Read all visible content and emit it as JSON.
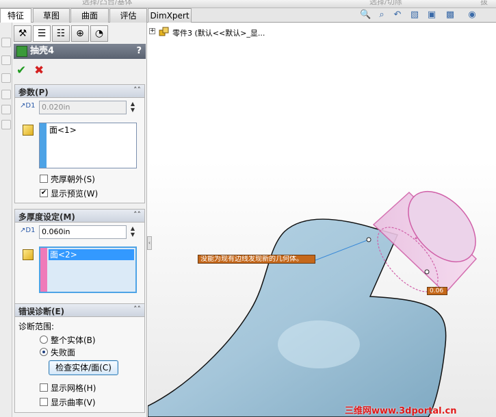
{
  "top_strip": {
    "left_ghost": "选择/凸台/基体",
    "middle_ghost": "选择/切除",
    "right_ghost": "拔"
  },
  "command_tabs": [
    {
      "label": "特征",
      "active": true
    },
    {
      "label": "草图",
      "active": false
    },
    {
      "label": "曲面",
      "active": false
    },
    {
      "label": "评估",
      "active": false
    },
    {
      "label": "DimXpert",
      "active": false
    }
  ],
  "view_toolbar": [
    "zoom-to-fit-icon",
    "zoom-area-icon",
    "previous-view-icon",
    "section-view-icon",
    "view-orientation-icon",
    "display-style-icon",
    "hide-show-icon"
  ],
  "property_manager": {
    "tabs": [
      "feature-manager-icon",
      "property-manager-icon",
      "configuration-manager-icon",
      "dimxpert-icon",
      "display-manager-icon"
    ],
    "feature_title": "抽壳4",
    "help": "?",
    "ok_symbol": "✔",
    "cancel_symbol": "✖",
    "parameters": {
      "header": "参数(P)",
      "thickness_value": "0.020in",
      "thickness_label": "D1",
      "faces": [
        "面<1>"
      ],
      "shell_outward": {
        "label": "壳厚朝外(S)",
        "checked": false
      },
      "show_preview": {
        "label": "显示预览(W)",
        "checked": true
      }
    },
    "multi_thickness": {
      "header": "多厚度设定(M)",
      "thickness_value": "0.060in",
      "thickness_label": "D1",
      "faces": [
        "面<2>"
      ]
    },
    "error_diagnostics": {
      "header": "错误诊断(E)",
      "scope_label": "诊断范围:",
      "options": [
        {
          "label": "整个实体(B)",
          "selected": false
        },
        {
          "label": "失败面",
          "selected": true
        }
      ],
      "check_button": "检查实体/面(C)",
      "show_mesh": {
        "label": "显示网格(H)",
        "checked": false
      },
      "show_curvature": {
        "label": "显示曲率(V)",
        "checked": false
      }
    }
  },
  "graphics": {
    "tree_item": "零件3 (默认<<默认>_显...",
    "error_callout": "没能为现有边线发现新的几何体。",
    "dim_tag": "0.06",
    "watermark": "三维网www.3dportal.cn"
  },
  "colors": {
    "selection_pink": "#e573b4",
    "part_blue": "#a8c8dc",
    "callout_orange": "#c5681b",
    "list_highlight": "#3399ff"
  }
}
